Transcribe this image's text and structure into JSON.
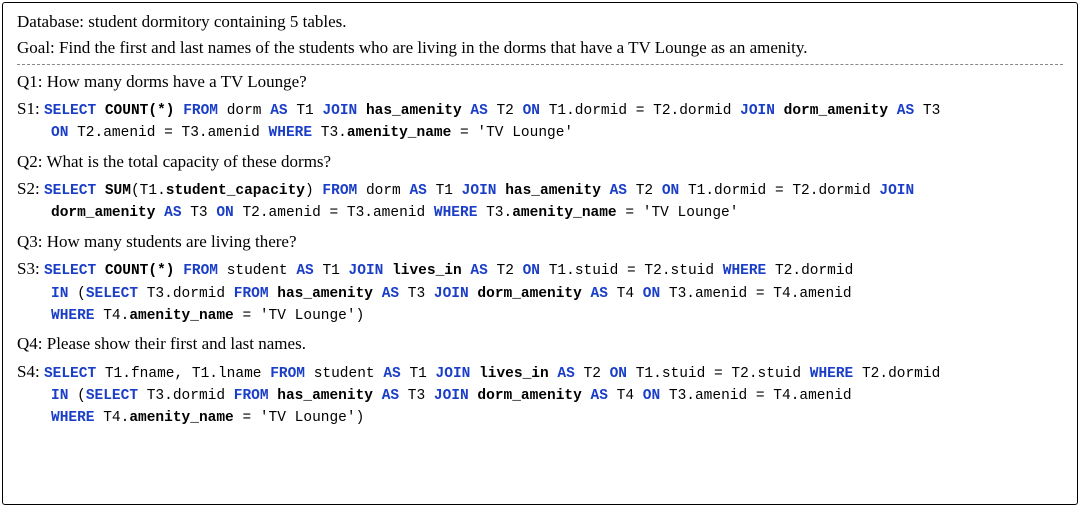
{
  "header": {
    "database": "Database: student dormitory containing 5 tables.",
    "goal": "Goal: Find the first and last names of the students who are living in the dorms that have a TV Lounge as an amenity."
  },
  "items": [
    {
      "qlabel": "Q1:",
      "question": "How many dorms have a TV Lounge?",
      "slabel": "S1:",
      "sql_tokens": [
        [
          "kw",
          "SELECT"
        ],
        [
          "sp",
          " "
        ],
        [
          "fn",
          "COUNT(*)"
        ],
        [
          "sp",
          " "
        ],
        [
          "kw",
          "FROM"
        ],
        [
          "sp",
          " "
        ],
        [
          "txt",
          "dorm "
        ],
        [
          "kw",
          "AS"
        ],
        [
          "sp",
          " "
        ],
        [
          "txt",
          "T1 "
        ],
        [
          "kw",
          "JOIN"
        ],
        [
          "sp",
          " "
        ],
        [
          "fn",
          "has_amenity"
        ],
        [
          "sp",
          " "
        ],
        [
          "kw",
          "AS"
        ],
        [
          "sp",
          " "
        ],
        [
          "txt",
          "T2 "
        ],
        [
          "kw",
          "ON"
        ],
        [
          "sp",
          " "
        ],
        [
          "txt",
          "T1.dormid = T2.dormid "
        ],
        [
          "kw",
          "JOIN"
        ],
        [
          "sp",
          " "
        ],
        [
          "fn",
          "dorm_amenity"
        ],
        [
          "sp",
          " "
        ],
        [
          "kw",
          "AS"
        ],
        [
          "sp",
          " "
        ],
        [
          "txt",
          "T3"
        ],
        [
          "br"
        ],
        [
          "kw",
          "ON"
        ],
        [
          "sp",
          " "
        ],
        [
          "txt",
          "T2.amenid = T3.amenid "
        ],
        [
          "kw",
          "WHERE"
        ],
        [
          "sp",
          " "
        ],
        [
          "txt",
          "T3."
        ],
        [
          "fn",
          "amenity_name"
        ],
        [
          "sp",
          " "
        ],
        [
          "txt",
          "= 'TV Lounge'"
        ]
      ]
    },
    {
      "qlabel": "Q2:",
      "question": "What is the total capacity of these dorms?",
      "slabel": "S2:",
      "sql_tokens": [
        [
          "kw",
          "SELECT"
        ],
        [
          "sp",
          " "
        ],
        [
          "fn",
          "SUM"
        ],
        [
          "txt",
          "(T1."
        ],
        [
          "fn",
          "student_capacity"
        ],
        [
          "txt",
          ") "
        ],
        [
          "kw",
          "FROM"
        ],
        [
          "sp",
          " "
        ],
        [
          "txt",
          "dorm "
        ],
        [
          "kw",
          "AS"
        ],
        [
          "sp",
          " "
        ],
        [
          "txt",
          "T1 "
        ],
        [
          "kw",
          "JOIN"
        ],
        [
          "sp",
          " "
        ],
        [
          "fn",
          "has_amenity"
        ],
        [
          "sp",
          " "
        ],
        [
          "kw",
          "AS"
        ],
        [
          "sp",
          " "
        ],
        [
          "txt",
          "T2 "
        ],
        [
          "kw",
          "ON"
        ],
        [
          "sp",
          " "
        ],
        [
          "txt",
          "T1.dormid = T2.dormid "
        ],
        [
          "kw",
          "JOIN"
        ],
        [
          "br"
        ],
        [
          "fn",
          "dorm_amenity"
        ],
        [
          "sp",
          " "
        ],
        [
          "kw",
          "AS"
        ],
        [
          "sp",
          " "
        ],
        [
          "txt",
          "T3 "
        ],
        [
          "kw",
          "ON"
        ],
        [
          "sp",
          " "
        ],
        [
          "txt",
          "T2.amenid = T3.amenid "
        ],
        [
          "kw",
          "WHERE"
        ],
        [
          "sp",
          " "
        ],
        [
          "txt",
          "T3."
        ],
        [
          "fn",
          "amenity_name"
        ],
        [
          "sp",
          " "
        ],
        [
          "txt",
          "= 'TV Lounge'"
        ]
      ]
    },
    {
      "qlabel": "Q3:",
      "question": "How many students are living there?",
      "slabel": "S3:",
      "sql_tokens": [
        [
          "kw",
          "SELECT"
        ],
        [
          "sp",
          " "
        ],
        [
          "fn",
          "COUNT(*)"
        ],
        [
          "sp",
          " "
        ],
        [
          "kw",
          "FROM"
        ],
        [
          "sp",
          " "
        ],
        [
          "txt",
          "student "
        ],
        [
          "kw",
          "AS"
        ],
        [
          "sp",
          " "
        ],
        [
          "txt",
          "T1 "
        ],
        [
          "kw",
          "JOIN"
        ],
        [
          "sp",
          " "
        ],
        [
          "fn",
          "lives_in"
        ],
        [
          "sp",
          " "
        ],
        [
          "kw",
          "AS"
        ],
        [
          "sp",
          " "
        ],
        [
          "txt",
          "T2 "
        ],
        [
          "kw",
          "ON"
        ],
        [
          "sp",
          " "
        ],
        [
          "txt",
          "T1.stuid = T2.stuid "
        ],
        [
          "kw",
          "WHERE"
        ],
        [
          "sp",
          " "
        ],
        [
          "txt",
          "T2.dormid"
        ],
        [
          "br"
        ],
        [
          "kw",
          "IN"
        ],
        [
          "sp",
          " "
        ],
        [
          "txt",
          "("
        ],
        [
          "kw",
          "SELECT"
        ],
        [
          "sp",
          " "
        ],
        [
          "txt",
          "T3.dormid "
        ],
        [
          "kw",
          "FROM"
        ],
        [
          "sp",
          " "
        ],
        [
          "fn",
          "has_amenity"
        ],
        [
          "sp",
          " "
        ],
        [
          "kw",
          "AS"
        ],
        [
          "sp",
          " "
        ],
        [
          "txt",
          "T3 "
        ],
        [
          "kw",
          "JOIN"
        ],
        [
          "sp",
          " "
        ],
        [
          "fn",
          "dorm_amenity"
        ],
        [
          "sp",
          " "
        ],
        [
          "kw",
          "AS"
        ],
        [
          "sp",
          " "
        ],
        [
          "txt",
          "T4 "
        ],
        [
          "kw",
          "ON"
        ],
        [
          "sp",
          " "
        ],
        [
          "txt",
          "T3.amenid = T4.amenid"
        ],
        [
          "br"
        ],
        [
          "kw",
          "WHERE"
        ],
        [
          "sp",
          " "
        ],
        [
          "txt",
          "T4."
        ],
        [
          "fn",
          "amenity_name"
        ],
        [
          "sp",
          " "
        ],
        [
          "txt",
          "= 'TV Lounge')"
        ]
      ]
    },
    {
      "qlabel": "Q4:",
      "question": "Please show their first and last names.",
      "slabel": "S4:",
      "sql_tokens": [
        [
          "kw",
          "SELECT"
        ],
        [
          "sp",
          " "
        ],
        [
          "txt",
          "T1.fname, T1.lname "
        ],
        [
          "kw",
          "FROM"
        ],
        [
          "sp",
          " "
        ],
        [
          "txt",
          "student "
        ],
        [
          "kw",
          "AS"
        ],
        [
          "sp",
          " "
        ],
        [
          "txt",
          "T1 "
        ],
        [
          "kw",
          "JOIN"
        ],
        [
          "sp",
          " "
        ],
        [
          "fn",
          "lives_in"
        ],
        [
          "sp",
          " "
        ],
        [
          "kw",
          "AS"
        ],
        [
          "sp",
          " "
        ],
        [
          "txt",
          "T2 "
        ],
        [
          "kw",
          "ON"
        ],
        [
          "sp",
          " "
        ],
        [
          "txt",
          "T1.stuid = T2.stuid "
        ],
        [
          "kw",
          "WHERE"
        ],
        [
          "sp",
          " "
        ],
        [
          "txt",
          "T2.dormid"
        ],
        [
          "br"
        ],
        [
          "kw",
          "IN"
        ],
        [
          "sp",
          " "
        ],
        [
          "txt",
          "("
        ],
        [
          "kw",
          "SELECT"
        ],
        [
          "sp",
          " "
        ],
        [
          "txt",
          "T3.dormid "
        ],
        [
          "kw",
          "FROM"
        ],
        [
          "sp",
          " "
        ],
        [
          "fn",
          "has_amenity"
        ],
        [
          "sp",
          " "
        ],
        [
          "kw",
          "AS"
        ],
        [
          "sp",
          " "
        ],
        [
          "txt",
          "T3 "
        ],
        [
          "kw",
          "JOIN"
        ],
        [
          "sp",
          " "
        ],
        [
          "fn",
          "dorm_amenity"
        ],
        [
          "sp",
          " "
        ],
        [
          "kw",
          "AS"
        ],
        [
          "sp",
          " "
        ],
        [
          "txt",
          "T4 "
        ],
        [
          "kw",
          "ON"
        ],
        [
          "sp",
          " "
        ],
        [
          "txt",
          "T3.amenid = T4.amenid"
        ],
        [
          "br"
        ],
        [
          "kw",
          "WHERE"
        ],
        [
          "sp",
          " "
        ],
        [
          "txt",
          "T4."
        ],
        [
          "fn",
          "amenity_name"
        ],
        [
          "sp",
          " "
        ],
        [
          "txt",
          "= 'TV Lounge')"
        ]
      ]
    }
  ]
}
